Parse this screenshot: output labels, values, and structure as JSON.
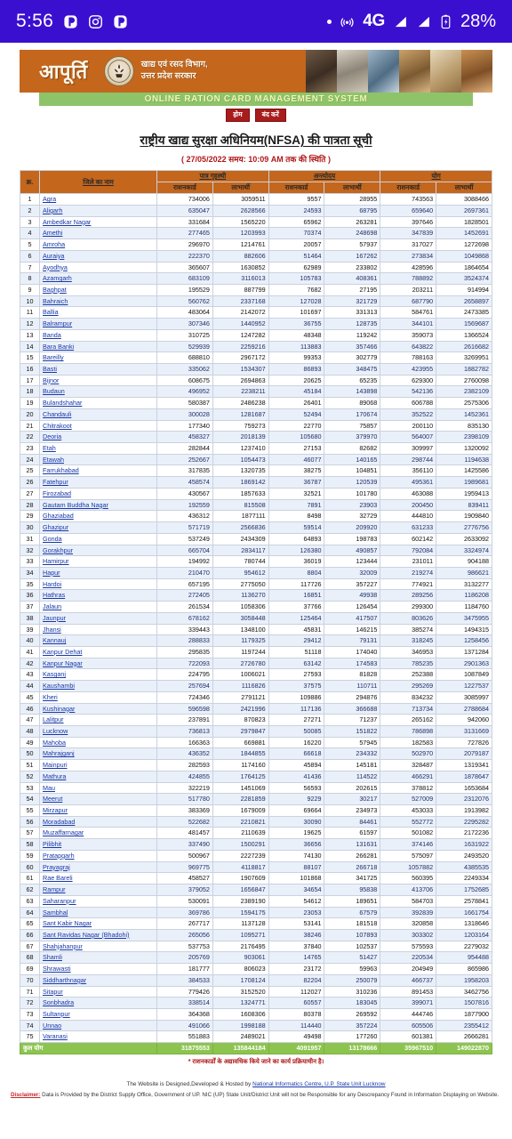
{
  "statusbar": {
    "time": "5:56",
    "left_icons": [
      "app-badge-icon",
      "instagram-icon",
      "app-badge-icon"
    ],
    "network_label": "4G",
    "battery_percent": "28%",
    "bg_color": "#3b0fd0",
    "right_icons": [
      "dot-icon",
      "hotspot-icon",
      "signal-bars-icon",
      "signal-bars-icon",
      "battery-charging-icon"
    ]
  },
  "banner": {
    "title": "आपूर्ति",
    "department_line1": "खाद्य एवं रसद विभाग,",
    "department_line2": "उत्तर प्रदेश सरकार",
    "strip_text": "ONLINE RATION CARD MANAGEMENT SYSTEM",
    "bg_color": "#c4661c",
    "strip_color": "#8dc46a"
  },
  "navbuttons": [
    {
      "label": "होम",
      "name": "home-button"
    },
    {
      "label": "बंद करें",
      "name": "close-button"
    }
  ],
  "headings": {
    "main_title": "राष्ट्रीय खाद्य सुरक्षा अधिनियम(NFSA) की पात्रता सूची",
    "sub_title": "( 27/05/2022 समय: 10:09 AM तक की स्थिति )"
  },
  "table": {
    "headers": {
      "sno": "क्र.",
      "district": "जिले का नाम",
      "groups": [
        "पात्र गृहस्थी",
        "अन्त्योदय",
        "योग"
      ],
      "sub": [
        "राशनकार्ड",
        "लाभार्थी"
      ]
    },
    "rows": [
      {
        "sno": 1,
        "district": "Agra",
        "v": [
          734006,
          3059511,
          9557,
          28955,
          743563,
          3088466
        ]
      },
      {
        "sno": 2,
        "district": "Aligarh",
        "v": [
          635047,
          2628566,
          24593,
          68795,
          659640,
          2697361
        ]
      },
      {
        "sno": 3,
        "district": "Ambedkar Nagar",
        "v": [
          331684,
          1565220,
          65962,
          263281,
          397646,
          1828501
        ]
      },
      {
        "sno": 4,
        "district": "Amethi",
        "v": [
          277465,
          1203993,
          70374,
          248698,
          347839,
          1452691
        ]
      },
      {
        "sno": 5,
        "district": "Amroha",
        "v": [
          296970,
          1214761,
          20057,
          57937,
          317027,
          1272698
        ]
      },
      {
        "sno": 6,
        "district": "Auraiya",
        "v": [
          222370,
          882606,
          51464,
          167262,
          273834,
          1049868
        ]
      },
      {
        "sno": 7,
        "district": "Ayodhya",
        "v": [
          365607,
          1630852,
          62989,
          233802,
          428596,
          1864654
        ]
      },
      {
        "sno": 8,
        "district": "Azamgarh",
        "v": [
          683109,
          3116013,
          105783,
          408361,
          788892,
          3524374
        ]
      },
      {
        "sno": 9,
        "district": "Baghpat",
        "v": [
          195529,
          887799,
          7682,
          27195,
          203211,
          914994
        ]
      },
      {
        "sno": 10,
        "district": "Bahraich",
        "v": [
          560762,
          2337168,
          127028,
          321729,
          687790,
          2658897
        ]
      },
      {
        "sno": 11,
        "district": "Ballia",
        "v": [
          483064,
          2142072,
          101697,
          331313,
          584761,
          2473385
        ]
      },
      {
        "sno": 12,
        "district": "Balrampur",
        "v": [
          307346,
          1440952,
          36755,
          128735,
          344101,
          1569687
        ]
      },
      {
        "sno": 13,
        "district": "Banda",
        "v": [
          310725,
          1247282,
          48348,
          119242,
          359073,
          1366524
        ]
      },
      {
        "sno": 14,
        "district": "Bara Banki",
        "v": [
          529939,
          2259216,
          113883,
          357466,
          643822,
          2616682
        ]
      },
      {
        "sno": 15,
        "district": "Bareilly",
        "v": [
          688810,
          2967172,
          99353,
          302779,
          788163,
          3269951
        ]
      },
      {
        "sno": 16,
        "district": "Basti",
        "v": [
          335062,
          1534307,
          86893,
          348475,
          423955,
          1882782
        ]
      },
      {
        "sno": 17,
        "district": "Bijnor",
        "v": [
          608675,
          2694863,
          20625,
          65235,
          629300,
          2760098
        ]
      },
      {
        "sno": 18,
        "district": "Budaun",
        "v": [
          496952,
          2238211,
          45184,
          143898,
          542136,
          2382109
        ]
      },
      {
        "sno": 19,
        "district": "Bulandshahar",
        "v": [
          580387,
          2486238,
          26401,
          89068,
          606788,
          2575306
        ]
      },
      {
        "sno": 20,
        "district": "Chandauli",
        "v": [
          300028,
          1281687,
          52494,
          170674,
          352522,
          1452361
        ]
      },
      {
        "sno": 21,
        "district": "Chitrakoot",
        "v": [
          177340,
          759273,
          22770,
          75857,
          200110,
          835130
        ]
      },
      {
        "sno": 22,
        "district": "Deoria",
        "v": [
          458327,
          2018139,
          105680,
          379970,
          564007,
          2398109
        ]
      },
      {
        "sno": 23,
        "district": "Etah",
        "v": [
          282844,
          1237410,
          27153,
          82682,
          309997,
          1320092
        ]
      },
      {
        "sno": 24,
        "district": "Etawah",
        "v": [
          252667,
          1054473,
          46077,
          140165,
          298744,
          1194638
        ]
      },
      {
        "sno": 25,
        "district": "Farrukhabad",
        "v": [
          317835,
          1320735,
          38275,
          104851,
          356110,
          1425586
        ]
      },
      {
        "sno": 26,
        "district": "Fatehpur",
        "v": [
          458574,
          1869142,
          36787,
          120539,
          495361,
          1989681
        ]
      },
      {
        "sno": 27,
        "district": "Firozabad",
        "v": [
          430567,
          1857633,
          32521,
          101780,
          463088,
          1959413
        ]
      },
      {
        "sno": 28,
        "district": "Gautam Buddha Nagar",
        "v": [
          192559,
          815508,
          7891,
          23903,
          200450,
          839411
        ]
      },
      {
        "sno": 29,
        "district": "Ghaziabad",
        "v": [
          436312,
          1877111,
          8498,
          32729,
          444810,
          1909840
        ]
      },
      {
        "sno": 30,
        "district": "Ghazipur",
        "v": [
          571719,
          2566836,
          59514,
          209920,
          631233,
          2776756
        ]
      },
      {
        "sno": 31,
        "district": "Gonda",
        "v": [
          537249,
          2434309,
          64893,
          198783,
          602142,
          2633092
        ]
      },
      {
        "sno": 32,
        "district": "Gorakhpur",
        "v": [
          665704,
          2834117,
          126380,
          490857,
          792084,
          3324974
        ]
      },
      {
        "sno": 33,
        "district": "Hamirpur",
        "v": [
          194992,
          780744,
          36019,
          123444,
          231011,
          904188
        ]
      },
      {
        "sno": 34,
        "district": "Hapur",
        "v": [
          210470,
          954612,
          8804,
          32009,
          219274,
          986621
        ]
      },
      {
        "sno": 35,
        "district": "Hardoi",
        "v": [
          657195,
          2775050,
          117726,
          357227,
          774921,
          3132277
        ]
      },
      {
        "sno": 36,
        "district": "Hathras",
        "v": [
          272405,
          1136270,
          16851,
          49938,
          289256,
          1186208
        ]
      },
      {
        "sno": 37,
        "district": "Jalaun",
        "v": [
          261534,
          1058306,
          37766,
          126454,
          299300,
          1184760
        ]
      },
      {
        "sno": 38,
        "district": "Jaunpur",
        "v": [
          678162,
          3058448,
          125464,
          417507,
          803626,
          3475955
        ]
      },
      {
        "sno": 39,
        "district": "Jhansi",
        "v": [
          339443,
          1348100,
          45831,
          146215,
          385274,
          1494315
        ]
      },
      {
        "sno": 40,
        "district": "Kannauj",
        "v": [
          288833,
          1179325,
          29412,
          79131,
          318245,
          1258456
        ]
      },
      {
        "sno": 41,
        "district": "Kanpur Dehat",
        "v": [
          295835,
          1197244,
          51118,
          174040,
          346953,
          1371284
        ]
      },
      {
        "sno": 42,
        "district": "Kanpur Nagar",
        "v": [
          722093,
          2726780,
          63142,
          174583,
          785235,
          2901363
        ]
      },
      {
        "sno": 43,
        "district": "Kasganj",
        "v": [
          224795,
          1006021,
          27593,
          81828,
          252388,
          1087849
        ]
      },
      {
        "sno": 44,
        "district": "Kaushambi",
        "v": [
          257694,
          1116826,
          37575,
          110711,
          295269,
          1227537
        ]
      },
      {
        "sno": 45,
        "district": "Kheri",
        "v": [
          724346,
          2791121,
          109886,
          294876,
          834232,
          3085997
        ]
      },
      {
        "sno": 46,
        "district": "Kushinagar",
        "v": [
          596598,
          2421996,
          117136,
          366688,
          713734,
          2788684
        ]
      },
      {
        "sno": 47,
        "district": "Lalitpur",
        "v": [
          237891,
          870823,
          27271,
          71237,
          265162,
          942060
        ]
      },
      {
        "sno": 48,
        "district": "Lucknow",
        "v": [
          736813,
          2979847,
          50085,
          151822,
          786898,
          3131669
        ]
      },
      {
        "sno": 49,
        "district": "Mahoba",
        "v": [
          166363,
          669881,
          16220,
          57945,
          182583,
          727826
        ]
      },
      {
        "sno": 50,
        "district": "Mahrajganj",
        "v": [
          436352,
          1844855,
          66618,
          234332,
          502970,
          2079187
        ]
      },
      {
        "sno": 51,
        "district": "Mainpuri",
        "v": [
          282593,
          1174160,
          45894,
          145181,
          328487,
          1319341
        ]
      },
      {
        "sno": 52,
        "district": "Mathura",
        "v": [
          424855,
          1764125,
          41436,
          114522,
          466291,
          1878647
        ]
      },
      {
        "sno": 53,
        "district": "Mau",
        "v": [
          322219,
          1451069,
          56593,
          202615,
          378812,
          1653684
        ]
      },
      {
        "sno": 54,
        "district": "Meerut",
        "v": [
          517780,
          2281859,
          9229,
          30217,
          527009,
          2312076
        ]
      },
      {
        "sno": 55,
        "district": "Mirzapur",
        "v": [
          383369,
          1679009,
          69664,
          234973,
          453033,
          1913982
        ]
      },
      {
        "sno": 56,
        "district": "Moradabad",
        "v": [
          522682,
          2210821,
          30090,
          84461,
          552772,
          2295282
        ]
      },
      {
        "sno": 57,
        "district": "Muzaffarnagar",
        "v": [
          481457,
          2110639,
          19625,
          61597,
          501082,
          2172236
        ]
      },
      {
        "sno": 58,
        "district": "Pilibhit",
        "v": [
          337490,
          1500291,
          36656,
          131631,
          374146,
          1631922
        ]
      },
      {
        "sno": 59,
        "district": "Pratapgarh",
        "v": [
          500967,
          2227239,
          74130,
          266281,
          575097,
          2493520
        ]
      },
      {
        "sno": 60,
        "district": "Prayagraj",
        "v": [
          969775,
          4118817,
          88107,
          266718,
          1057882,
          4385535
        ]
      },
      {
        "sno": 61,
        "district": "Rae Bareli",
        "v": [
          458527,
          1907609,
          101868,
          341725,
          560395,
          2249334
        ]
      },
      {
        "sno": 62,
        "district": "Rampur",
        "v": [
          379052,
          1656847,
          34654,
          95838,
          413706,
          1752685
        ]
      },
      {
        "sno": 63,
        "district": "Saharanpur",
        "v": [
          530091,
          2389190,
          54612,
          189651,
          584703,
          2578841
        ]
      },
      {
        "sno": 64,
        "district": "Sambhal",
        "v": [
          369786,
          1594175,
          23053,
          67579,
          392839,
          1661754
        ]
      },
      {
        "sno": 65,
        "district": "Sant Kabir Nagar",
        "v": [
          267717,
          1137128,
          53141,
          181518,
          320858,
          1318646
        ]
      },
      {
        "sno": 66,
        "district": "Sant Ravidas Nagar (Bhadohi)",
        "v": [
          265056,
          1095271,
          38246,
          107893,
          303302,
          1203164
        ]
      },
      {
        "sno": 67,
        "district": "Shahjahanpur",
        "v": [
          537753,
          2176495,
          37840,
          102537,
          575593,
          2279032
        ]
      },
      {
        "sno": 68,
        "district": "Shamli",
        "v": [
          205769,
          903061,
          14765,
          51427,
          220534,
          954488
        ]
      },
      {
        "sno": 69,
        "district": "Shrawasti",
        "v": [
          181777,
          806023,
          23172,
          59963,
          204949,
          865986
        ]
      },
      {
        "sno": 70,
        "district": "Siddharthnagar",
        "v": [
          384533,
          1708124,
          82204,
          250079,
          466737,
          1958203
        ]
      },
      {
        "sno": 71,
        "district": "Sitapur",
        "v": [
          779426,
          3152520,
          112027,
          310236,
          891453,
          3462756
        ]
      },
      {
        "sno": 72,
        "district": "Sonbhadra",
        "v": [
          338514,
          1324771,
          60557,
          183045,
          399071,
          1507816
        ]
      },
      {
        "sno": 73,
        "district": "Sultanpur",
        "v": [
          364368,
          1608306,
          80378,
          269592,
          444746,
          1877900
        ]
      },
      {
        "sno": 74,
        "district": "Unnao",
        "v": [
          491066,
          1998188,
          114440,
          357224,
          605506,
          2355412
        ]
      },
      {
        "sno": 75,
        "district": "Varanasi",
        "v": [
          551883,
          2489021,
          49498,
          177260,
          601381,
          2666281
        ]
      }
    ],
    "total": {
      "label": "कुल योग",
      "v": [
        31875553,
        135844184,
        4091957,
        13178666,
        35967510,
        149022870
      ]
    }
  },
  "note": "* राशनकार्डों के अद्यावधिक किये जाने का कार्य प्रक्रियाधीन है।",
  "footer": {
    "line1_prefix": "The Website is Designed,Developed & Hosted by ",
    "line1_link": "National Informatics Centre, U.P. State Unit Lucknow",
    "disclaimer_label": "Disclaimer:",
    "disclaimer_text": " Data is Provided by the District Supply Office, Government of UP. NIC (UP) State Unit/District Unit will not be Responsible for any Descrepancy Found in Information Displaying on Website."
  }
}
